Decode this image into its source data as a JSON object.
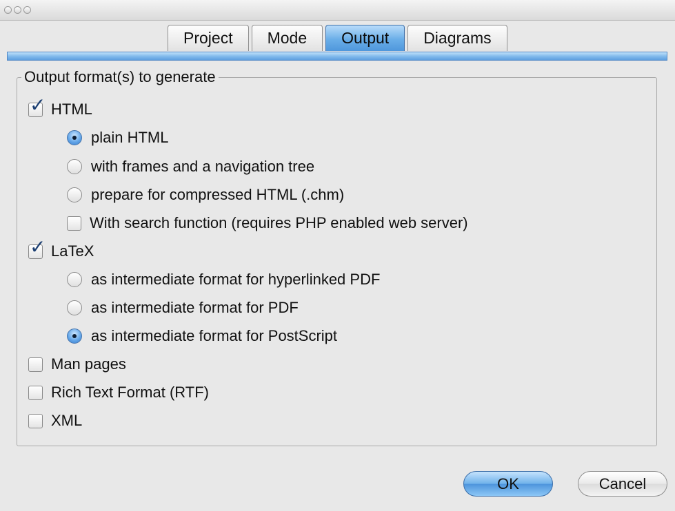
{
  "tabs": [
    {
      "label": "Project",
      "active": false
    },
    {
      "label": "Mode",
      "active": false
    },
    {
      "label": "Output",
      "active": true
    },
    {
      "label": "Diagrams",
      "active": false
    }
  ],
  "group": {
    "title": "Output format(s) to generate"
  },
  "options": {
    "html": {
      "label": "HTML",
      "checked": true
    },
    "plain_html": {
      "label": "plain HTML",
      "selected": true
    },
    "frames": {
      "label": "with frames and a navigation tree",
      "selected": false
    },
    "chm": {
      "label": "prepare for compressed HTML (.chm)",
      "selected": false
    },
    "search": {
      "label": "With search function (requires PHP enabled web server)",
      "checked": false
    },
    "latex": {
      "label": "LaTeX",
      "checked": true
    },
    "hyper_pdf": {
      "label": "as intermediate format for hyperlinked PDF",
      "selected": false
    },
    "pdf": {
      "label": "as intermediate format for PDF",
      "selected": false
    },
    "postscript": {
      "label": "as intermediate format for PostScript",
      "selected": true
    },
    "man": {
      "label": "Man pages",
      "checked": false
    },
    "rtf": {
      "label": "Rich Text Format (RTF)",
      "checked": false
    },
    "xml": {
      "label": "XML",
      "checked": false
    }
  },
  "buttons": {
    "ok": "OK",
    "cancel": "Cancel"
  },
  "colors": {
    "accent": "#5e9fe0",
    "background": "#e8e8e8"
  }
}
